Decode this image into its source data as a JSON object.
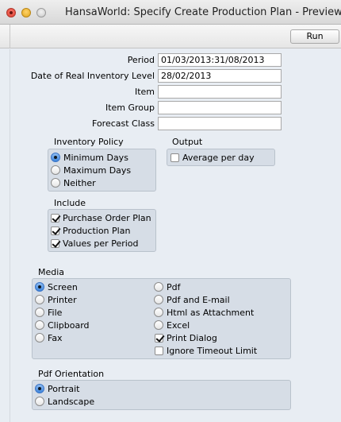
{
  "window": {
    "title": "HansaWorld: Specify Create Production Plan - Preview",
    "run_label": "Run"
  },
  "fields": {
    "period": {
      "label": "Period",
      "value": "01/03/2013:31/08/2013"
    },
    "date_real_inventory": {
      "label": "Date of Real Inventory Level",
      "value": "28/02/2013"
    },
    "item": {
      "label": "Item",
      "value": ""
    },
    "item_group": {
      "label": "Item Group",
      "value": ""
    },
    "forecast_class": {
      "label": "Forecast Class",
      "value": ""
    }
  },
  "inventory_policy": {
    "label": "Inventory Policy",
    "options": [
      {
        "label": "Minimum Days",
        "selected": true
      },
      {
        "label": "Maximum Days",
        "selected": false
      },
      {
        "label": "Neither",
        "selected": false
      }
    ]
  },
  "output": {
    "label": "Output",
    "options": [
      {
        "label": "Average per day",
        "checked": false
      }
    ]
  },
  "include": {
    "label": "Include",
    "options": [
      {
        "label": "Purchase Order Plan",
        "checked": true
      },
      {
        "label": "Production Plan",
        "checked": true
      },
      {
        "label": "Values per Period",
        "checked": true
      }
    ]
  },
  "media": {
    "label": "Media",
    "left": [
      {
        "label": "Screen",
        "selected": true
      },
      {
        "label": "Printer",
        "selected": false
      },
      {
        "label": "File",
        "selected": false
      },
      {
        "label": "Clipboard",
        "selected": false
      },
      {
        "label": "Fax",
        "selected": false
      }
    ],
    "right": [
      {
        "label": "Pdf",
        "selected": false
      },
      {
        "label": "Pdf and E-mail",
        "selected": false
      },
      {
        "label": "Html as Attachment",
        "selected": false
      },
      {
        "label": "Excel",
        "selected": false
      }
    ],
    "print_dialog": {
      "label": "Print Dialog",
      "checked": true
    },
    "ignore_timeout": {
      "label": "Ignore Timeout Limit",
      "checked": false
    }
  },
  "pdf_orientation": {
    "label": "Pdf Orientation",
    "options": [
      {
        "label": "Portrait",
        "selected": true
      },
      {
        "label": "Landscape",
        "selected": false
      }
    ]
  }
}
